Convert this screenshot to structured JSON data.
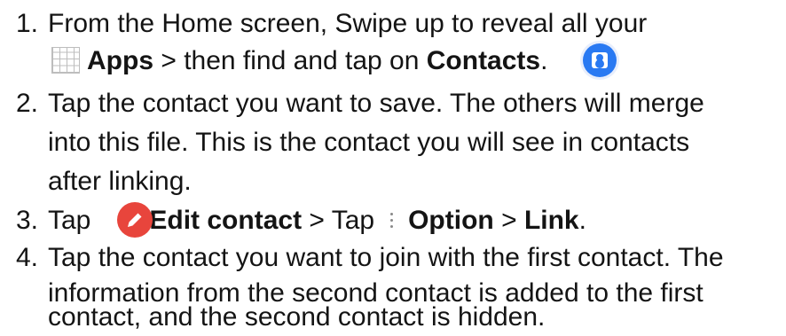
{
  "steps": [
    {
      "number": "1.",
      "line1": "From the Home screen, Swipe up to reveal all your",
      "apps_label": "Apps",
      "mid": " > then find and tap on ",
      "contacts_label": "Contacts",
      "end": "."
    },
    {
      "number": "2.",
      "lines": [
        "Tap the contact you want to save. The others will merge",
        "into this file. This is the contact you will see in contacts",
        "after linking."
      ]
    },
    {
      "number": "3.",
      "tap1": "Tap",
      "edit_label": "Edit contact",
      "mid": " > Tap",
      "option_label": "Option",
      "sep": " > ",
      "link_label": "Link",
      "end": "."
    },
    {
      "number": "4.",
      "lines": [
        "Tap the contact you want to join with the first contact. The",
        "information from the second contact is added to the first",
        "contact, and the second contact is hidden."
      ]
    }
  ],
  "icons": {
    "apps": "apps-grid-icon",
    "contacts": "contacts-app-icon",
    "edit": "edit-pencil-icon",
    "more": "more-options-icon"
  },
  "colors": {
    "contacts_icon": "#2979f2",
    "edit_icon": "#e8453c"
  }
}
